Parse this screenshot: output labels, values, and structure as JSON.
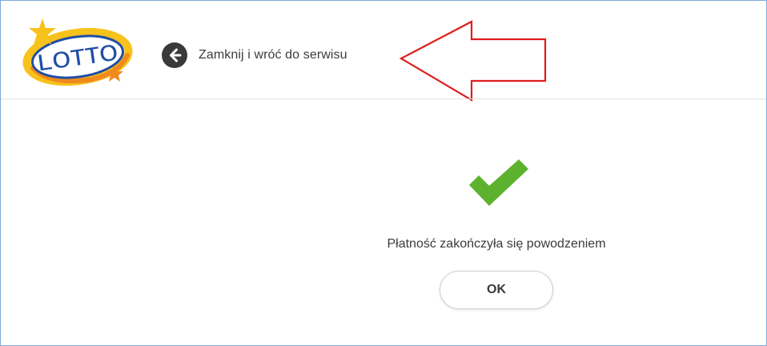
{
  "header": {
    "logo_alt": "LOTTO",
    "back_link_label": "Zamknij i wróć do serwisu",
    "back_icon": "arrow-left-circle-icon"
  },
  "annotation": {
    "type": "arrow",
    "direction": "left",
    "color": "#e01d1d"
  },
  "main": {
    "status_icon": "checkmark-icon",
    "status_color": "#5cb22e",
    "message": "Płatność zakończyła się powodzeniem",
    "ok_button_label": "OK"
  },
  "colors": {
    "frame_border": "#7fa9d8",
    "logo_blue": "#1f4ea6",
    "logo_yellow": "#f7c21b",
    "logo_orange": "#f08a1c",
    "text": "#3c3c3c"
  }
}
